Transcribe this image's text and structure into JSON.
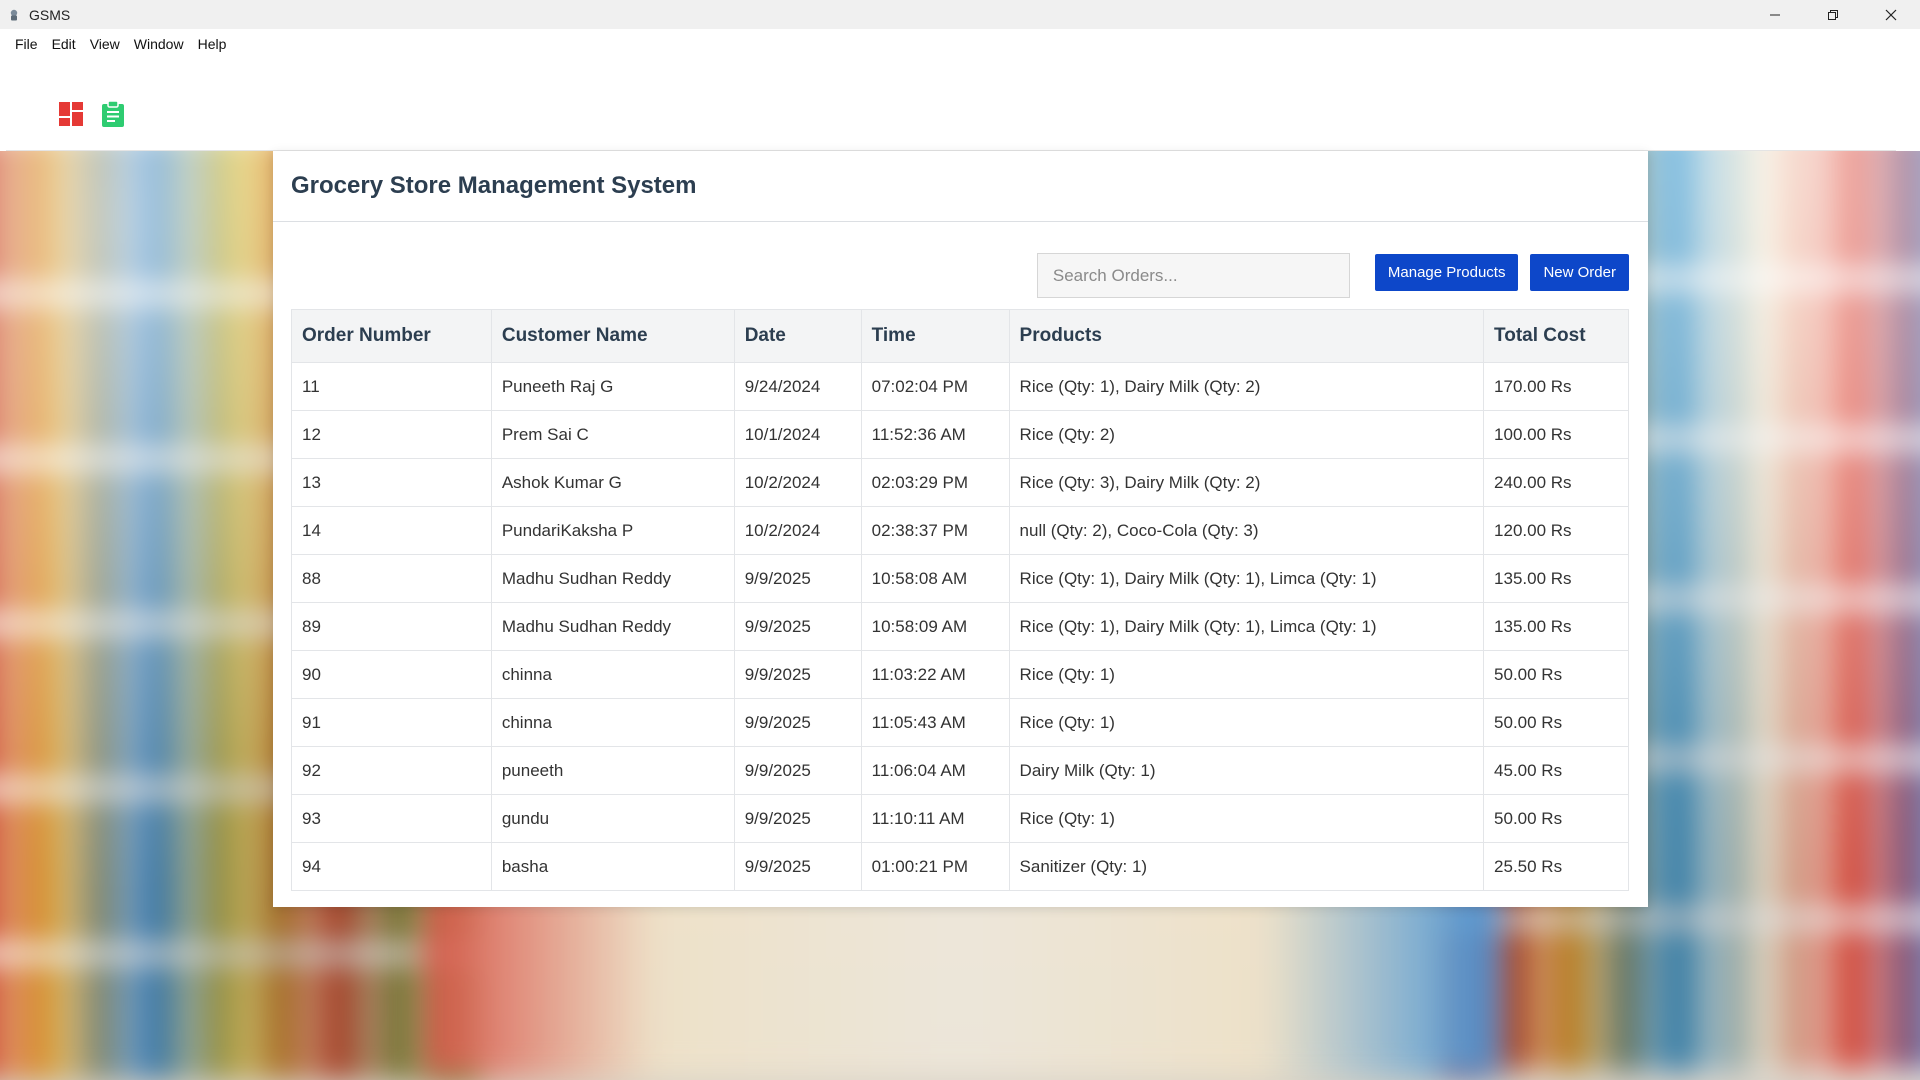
{
  "window": {
    "title": "GSMS",
    "controls": {
      "minimize": "—",
      "restore": "❐",
      "close": "✕"
    }
  },
  "menu": [
    "File",
    "Edit",
    "View",
    "Window",
    "Help"
  ],
  "toolbar": {
    "icons": [
      {
        "name": "dashboard-icon",
        "color": "#e53935"
      },
      {
        "name": "orders-clipboard-icon",
        "color": "#2ecc71"
      }
    ]
  },
  "main": {
    "title": "Grocery Store Management System",
    "search": {
      "placeholder": "Search Orders...",
      "value": ""
    },
    "buttons": {
      "manage_products": "Manage Products",
      "new_order": "New Order"
    },
    "accent_color": "#0d47c9"
  },
  "table": {
    "columns": [
      "Order Number",
      "Customer Name",
      "Date",
      "Time",
      "Products",
      "Total Cost"
    ],
    "rows": [
      [
        "11",
        "Puneeth Raj G",
        "9/24/2024",
        "07:02:04 PM",
        "Rice (Qty: 1), Dairy Milk (Qty: 2)",
        "170.00 Rs"
      ],
      [
        "12",
        "Prem Sai C",
        "10/1/2024",
        "11:52:36 AM",
        "Rice (Qty: 2)",
        "100.00 Rs"
      ],
      [
        "13",
        "Ashok Kumar G",
        "10/2/2024",
        "02:03:29 PM",
        "Rice (Qty: 3), Dairy Milk (Qty: 2)",
        "240.00 Rs"
      ],
      [
        "14",
        "PundariKaksha P",
        "10/2/2024",
        "02:38:37 PM",
        "null (Qty: 2), Coco-Cola (Qty: 3)",
        "120.00 Rs"
      ],
      [
        "88",
        "Madhu Sudhan Reddy",
        "9/9/2025",
        "10:58:08 AM",
        "Rice (Qty: 1), Dairy Milk (Qty: 1), Limca (Qty: 1)",
        "135.00 Rs"
      ],
      [
        "89",
        "Madhu Sudhan Reddy",
        "9/9/2025",
        "10:58:09 AM",
        "Rice (Qty: 1), Dairy Milk (Qty: 1), Limca (Qty: 1)",
        "135.00 Rs"
      ],
      [
        "90",
        "chinna",
        "9/9/2025",
        "11:03:22 AM",
        "Rice (Qty: 1)",
        "50.00 Rs"
      ],
      [
        "91",
        "chinna",
        "9/9/2025",
        "11:05:43 AM",
        "Rice (Qty: 1)",
        "50.00 Rs"
      ],
      [
        "92",
        "puneeth",
        "9/9/2025",
        "11:06:04 AM",
        "Dairy Milk (Qty: 1)",
        "45.00 Rs"
      ],
      [
        "93",
        "gundu",
        "9/9/2025",
        "11:10:11 AM",
        "Rice (Qty: 1)",
        "50.00 Rs"
      ],
      [
        "94",
        "basha",
        "9/9/2025",
        "01:00:21 PM",
        "Sanitizer (Qty: 1)",
        "25.50 Rs"
      ]
    ]
  }
}
